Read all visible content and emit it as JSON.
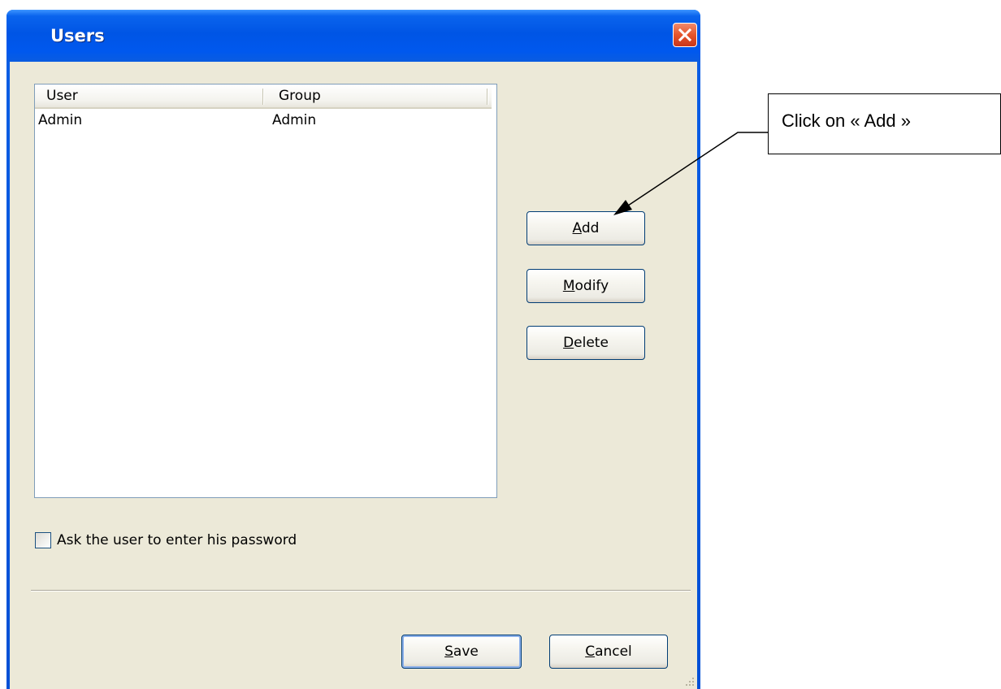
{
  "window": {
    "title": "Users"
  },
  "users_list": {
    "columns": [
      "User",
      "Group"
    ],
    "rows": [
      {
        "user": "Admin",
        "group": "Admin"
      }
    ]
  },
  "buttons": {
    "add": {
      "pre": "",
      "accel": "A",
      "post": "dd"
    },
    "modify": {
      "pre": "",
      "accel": "M",
      "post": "odify"
    },
    "delete": {
      "pre": "",
      "accel": "D",
      "post": "elete"
    },
    "save": {
      "pre": "",
      "accel": "S",
      "post": "ave"
    },
    "cancel": {
      "pre": "",
      "accel": "C",
      "post": "ancel"
    }
  },
  "checkbox": {
    "label": "Ask the user to enter his password",
    "checked": false
  },
  "annotation": {
    "text": "Click on « Add »"
  },
  "icons": {
    "close": "close-icon",
    "grip": "resize-grip-icon"
  },
  "colors": {
    "titlebar": "#0055e5",
    "client_bg": "#ece9d8",
    "close_button": "#e5542b",
    "button_border": "#003c74"
  }
}
